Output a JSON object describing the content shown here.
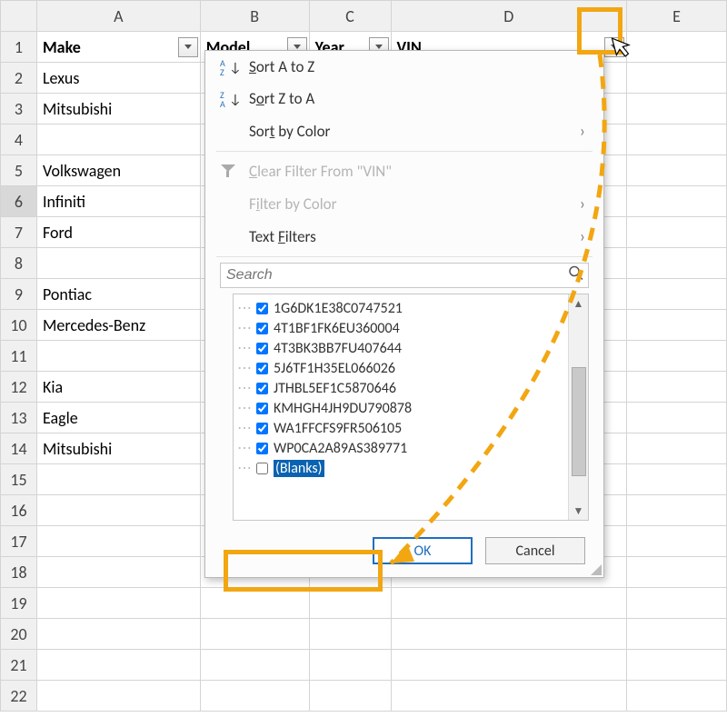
{
  "columns": {
    "A": "A",
    "B": "B",
    "C": "C",
    "D": "D",
    "E": "E"
  },
  "headers": {
    "make": "Make",
    "model": "Model",
    "year": "Year",
    "vin": "VIN"
  },
  "rows": [
    "Lexus",
    "Mitsubishi",
    "",
    "Volkswagen",
    "Infiniti",
    "Ford",
    "",
    "Pontiac",
    "Mercedes-Benz",
    "",
    "Kia",
    "Eagle",
    "Mitsubishi",
    "",
    "",
    "",
    "",
    "",
    "",
    "",
    ""
  ],
  "menu": {
    "sort_az": "Sort A to Z",
    "sort_za": "Sort Z to A",
    "sort_color": "Sort by Color",
    "clear_filter": "Clear Filter From \"VIN\"",
    "filter_color": "Filter by Color",
    "text_filters": "Text Filters",
    "search_placeholder": "Search"
  },
  "filter_items": [
    {
      "label": "1G6DK1E38C0747521",
      "checked": true
    },
    {
      "label": "4T1BF1FK6EU360004",
      "checked": true
    },
    {
      "label": "4T3BK3BB7FU407644",
      "checked": true
    },
    {
      "label": "5J6TF1H35EL066026",
      "checked": true
    },
    {
      "label": "JTHBL5EF1C5870646",
      "checked": true
    },
    {
      "label": "KMHGH4JH9DU790878",
      "checked": true
    },
    {
      "label": "WA1FFCFS9FR506105",
      "checked": true
    },
    {
      "label": "WP0CA2A89AS389771",
      "checked": true
    },
    {
      "label": "(Blanks)",
      "checked": false,
      "selected": true
    }
  ],
  "buttons": {
    "ok": "OK",
    "cancel": "Cancel"
  }
}
